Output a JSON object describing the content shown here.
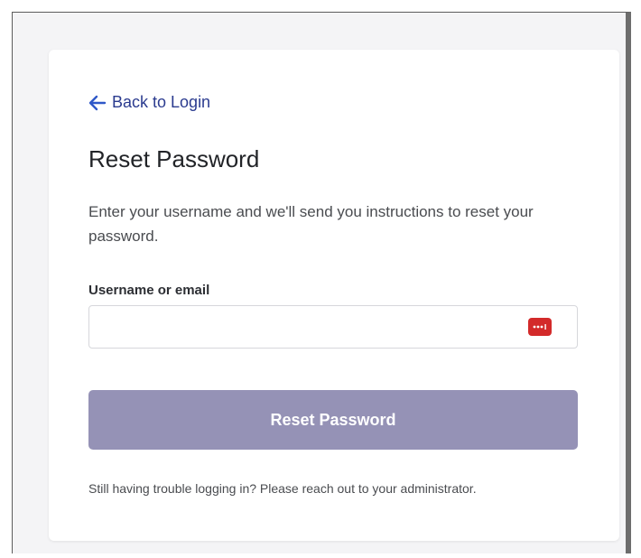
{
  "back_link": {
    "label": "Back to Login",
    "icon": "arrow-left-icon"
  },
  "heading": "Reset Password",
  "description": "Enter your username and we'll send you instructions to reset your password.",
  "form": {
    "label": "Username or email",
    "value": "",
    "placeholder": "",
    "field_icon": "password-manager-icon"
  },
  "submit_label": "Reset Password",
  "help_text": "Still having trouble logging in? Please reach out to your administrator.",
  "colors": {
    "accent": "#2b3b8f",
    "button": "#9592b6",
    "field_icon": "#d32a2a"
  }
}
